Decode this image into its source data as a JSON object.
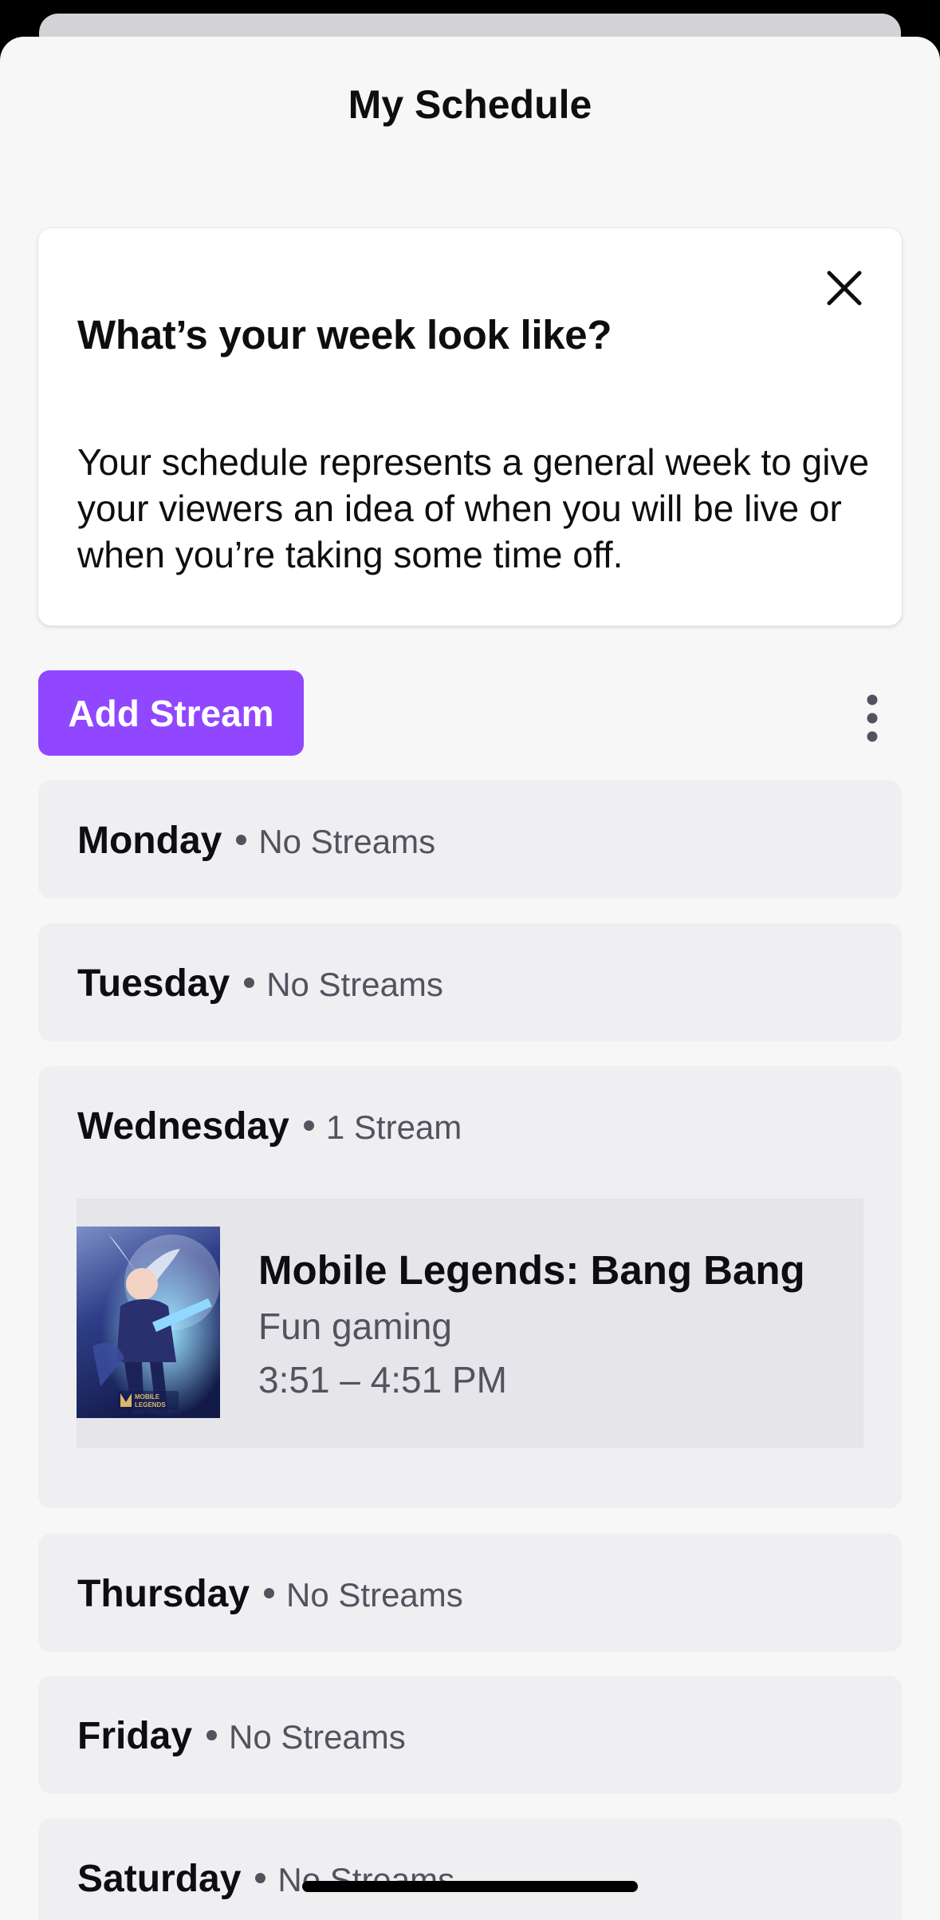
{
  "sheet": {
    "title": "My Schedule"
  },
  "info_card": {
    "title": "What’s your week look like?",
    "body": "Your schedule represents a general week to give your viewers an idea of when you will be live or when you’re taking some time off.",
    "close_icon": "close-icon"
  },
  "actions": {
    "add_stream_label": "Add Stream",
    "more_icon": "vertical-ellipsis-icon"
  },
  "days": [
    {
      "name": "Monday",
      "count": "No Streams"
    },
    {
      "name": "Tuesday",
      "count": "No Streams"
    },
    {
      "name": "Wednesday",
      "count": "1 Stream",
      "streams": [
        {
          "game": "Mobile Legends: Bang Bang",
          "title": "Fun gaming",
          "time": "3:51 – 4:51 PM",
          "art_logo": "MOBILE LEGENDS"
        }
      ]
    },
    {
      "name": "Thursday",
      "count": "No Streams"
    },
    {
      "name": "Friday",
      "count": "No Streams"
    },
    {
      "name": "Saturday",
      "count": "No Streams"
    }
  ],
  "colors": {
    "accent": "#9147ff",
    "sheet_background": "#f7f7f8",
    "card_background": "#efeff1",
    "stream_background": "#e5e5ea",
    "text_primary": "#0e0e10",
    "text_secondary": "#53535f"
  }
}
